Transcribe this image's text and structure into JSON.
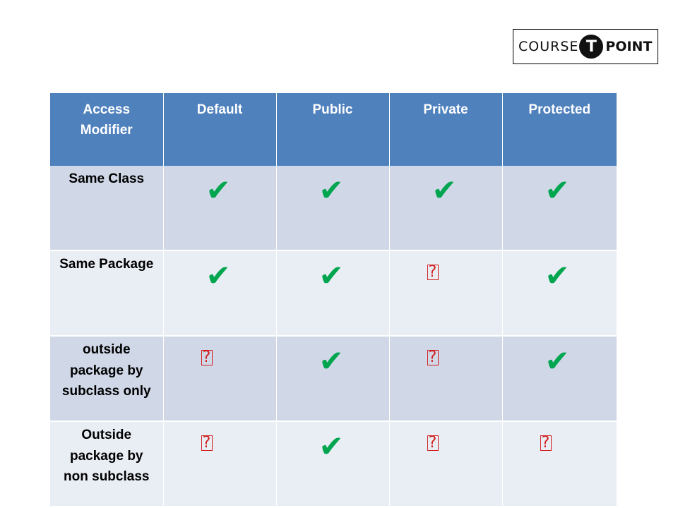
{
  "logo": {
    "left": "COURSE",
    "middle": "T",
    "right": "POINT"
  },
  "table": {
    "headers": [
      "Access Modifier",
      "Default",
      "Public",
      "Private",
      "Protected"
    ],
    "rows": [
      {
        "label": "Same Class",
        "cells": [
          "✔",
          "✔",
          "✔",
          "✔"
        ]
      },
      {
        "label": "Same Package",
        "cells": [
          "✔",
          "✔",
          "?",
          "✔"
        ]
      },
      {
        "label": "outside package by subclass only",
        "cells": [
          "?",
          "✔",
          "?",
          "✔"
        ]
      },
      {
        "label": "Outside package by non subclass",
        "cells": [
          "?",
          "✔",
          "?",
          "?"
        ]
      }
    ]
  },
  "colors": {
    "header": "#4f81bd",
    "row_dark": "#d0d8e8",
    "row_light": "#e9edf4",
    "check": "#00a550",
    "missing": "#d21f1f"
  }
}
